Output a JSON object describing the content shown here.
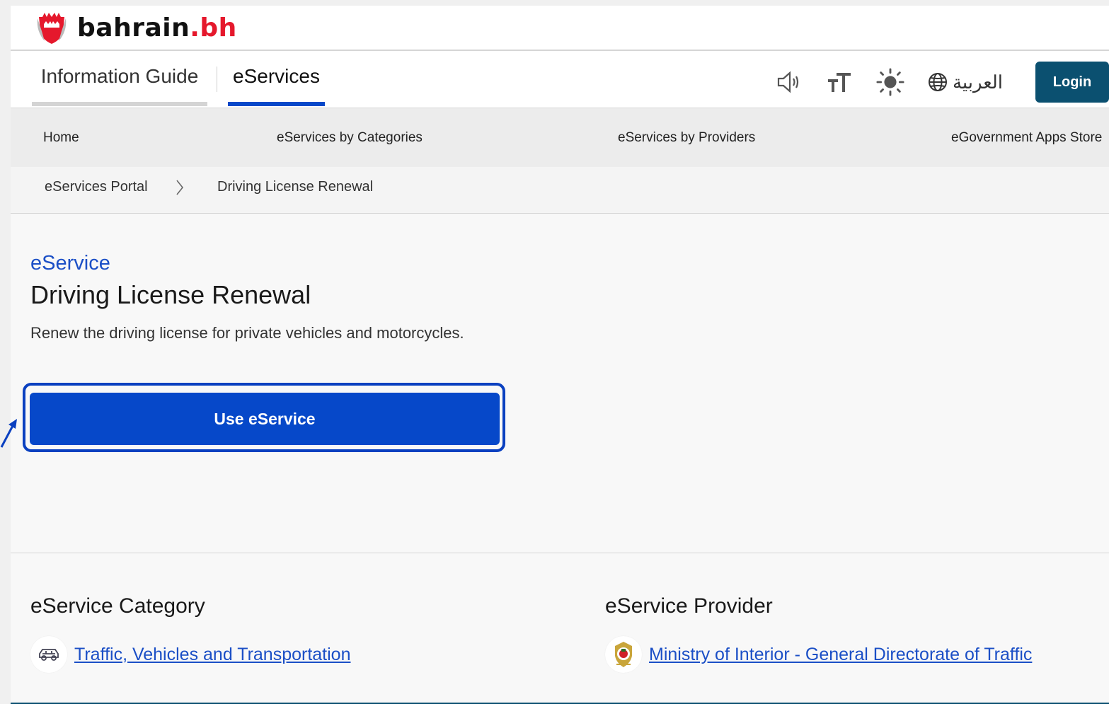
{
  "brand": {
    "name": "bahrain",
    "suffix": ".bh"
  },
  "tabs": [
    {
      "label": "Information Guide",
      "active": false
    },
    {
      "label": "eServices",
      "active": true
    }
  ],
  "tools": {
    "icons": [
      "speaker-icon",
      "text-size-icon",
      "brightness-icon",
      "globe-icon"
    ],
    "language_label": "العربية",
    "login_label": "Login"
  },
  "menu": [
    {
      "label": "Home"
    },
    {
      "label": "eServices by Categories"
    },
    {
      "label": "eServices by Providers"
    },
    {
      "label": "eGovernment Apps Store"
    }
  ],
  "breadcrumb": [
    {
      "label": "eServices Portal"
    },
    {
      "label": "Driving License Renewal"
    }
  ],
  "hero": {
    "label": "eService",
    "title": "Driving License Renewal",
    "description": "Renew the driving license for private vehicles and motorcycles.",
    "cta_label": "Use eService"
  },
  "category": {
    "title": "eService Category",
    "link": "Traffic, Vehicles and Transportation",
    "icon": "car-icon"
  },
  "provider": {
    "title": "eService Provider",
    "link": "Ministry of Interior - General Directorate of Traffic",
    "icon": "ministry-emblem-icon"
  },
  "colors": {
    "accent": "#0648c9",
    "link": "#1b4fc6",
    "login_bg": "#0b5070",
    "brand_red": "#e5182c"
  }
}
